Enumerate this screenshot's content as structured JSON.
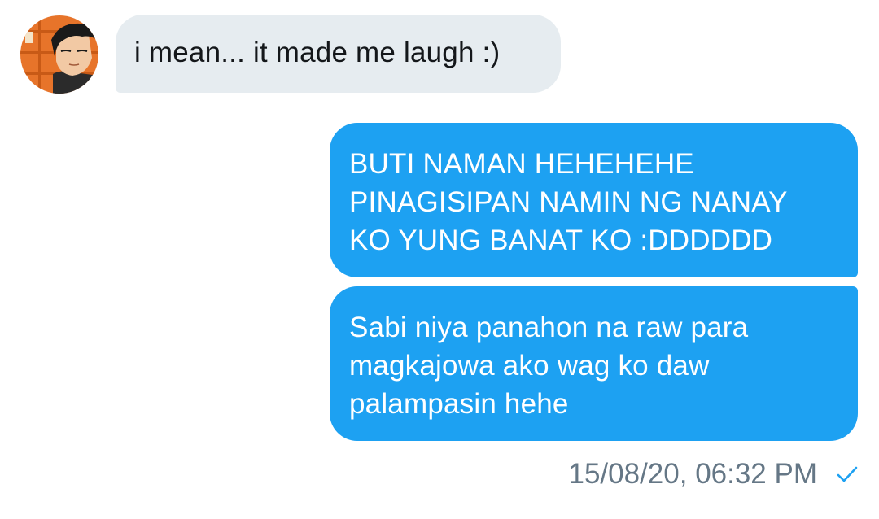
{
  "conversation": {
    "incoming": {
      "text": "i mean... it made me laugh :)",
      "avatar_icon": "anime-character-avatar-icon"
    },
    "outgoing": [
      {
        "lines": [
          "BUTI NAMAN HEHEHEHE",
          "PINAGISIPAN NAMIN NG NANAY",
          "KO YUNG BANAT KO :DDDDDD"
        ]
      },
      {
        "lines": [
          "Sabi niya panahon na raw para",
          "magkajowa ako wag ko daw",
          "palampasin hehe"
        ]
      }
    ],
    "meta": {
      "timestamp": "15/08/20, 06:32 PM",
      "status_icon": "checkmark-icon"
    }
  },
  "colors": {
    "incoming_bubble": "#e6ecf0",
    "outgoing_bubble": "#1da1f2",
    "meta_text": "#657786",
    "check": "#1da1f2"
  }
}
